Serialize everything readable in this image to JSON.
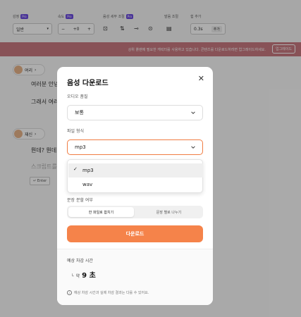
{
  "toolbar": {
    "groups": [
      {
        "label": "감정",
        "pro": "Pro"
      },
      {
        "label": "속도",
        "pro": "Pro"
      },
      {
        "label": "음성 세부 조절",
        "pro": "Pro"
      },
      {
        "label": "발음 조절",
        "pro": ""
      },
      {
        "label": "쉼 추가",
        "pro": ""
      }
    ],
    "emotion_value": "일반",
    "speed_minus": "−",
    "speed_value": "+0",
    "speed_plus": "+",
    "pause_value": "0.3s",
    "pause_add": "추가"
  },
  "banner": {
    "text": "상위 플랜에 필요한 캐릭터를 사용하고 있습니다. 콘텐츠를 다운로드하려면 업그레이드하세요.",
    "button": "업그레이드"
  },
  "script": {
    "speaker1": "여리",
    "line1": "여러분 안녕",
    "line2": "그래서 여러",
    "speaker2": "재신",
    "line3": "뭔데? 뭔데",
    "line4": "스크립트를",
    "enter": "Enter"
  },
  "modal": {
    "title": "음성 다운로드",
    "audio_quality_label": "오디오 품질",
    "audio_quality_value": "보통",
    "file_format_label": "파일 형식",
    "file_format_value": "mp3",
    "format_options": [
      "mp3",
      "wav"
    ],
    "split_label": "문장 분할 여부",
    "split_options": [
      "한 파일로 합치기",
      "문장 별로 나누기"
    ],
    "download_button": "다운로드",
    "estimate_label": "예상 차감 시간",
    "estimate_prefix": "약",
    "estimate_value": "9 초",
    "note": "예상 차감 시간과 실제 차감 결과는 다를 수 있어요."
  },
  "colors": {
    "accent": "#f5834a",
    "pro_badge": "#6c4ce0",
    "banner": "#c97a80"
  }
}
